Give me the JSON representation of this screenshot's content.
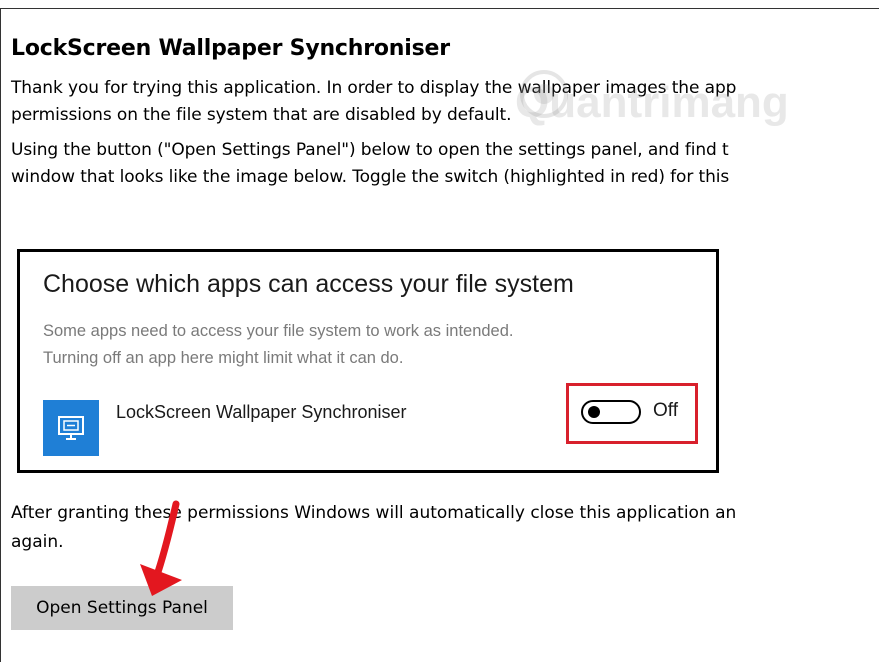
{
  "page": {
    "title": "LockScreen Wallpaper Synchroniser",
    "intro_lines": [
      "Thank you for trying this application. In order to display the wallpaper images the app",
      "permissions on the file system that are disabled by default."
    ],
    "instructions_lines": [
      "Using the button (\"Open Settings Panel\") below to open the settings panel, and find t",
      "window that looks like the image below. Toggle the switch (highlighted in red) for this"
    ],
    "after_lines": [
      "After granting these permissions Windows will automatically close this application an",
      "again."
    ]
  },
  "dialog": {
    "heading": "Choose which apps can access your file system",
    "desc_lines": [
      "Some apps need to access your file system to work as intended.",
      "Turning off an app here might limit what it can do."
    ],
    "app_name": "LockScreen Wallpaper Synchroniser",
    "app_icon": "monitor-icon",
    "toggle_state": "Off",
    "toggle_on": false,
    "highlight_color": "#d8202c",
    "icon_color": "#1f7fd6"
  },
  "actions": {
    "open_settings_label": "Open Settings Panel"
  },
  "watermark": {
    "text": "Quantrimang"
  },
  "annotation": {
    "arrow_color": "#e3171f",
    "arrow_icon": "red-arrow-icon"
  }
}
